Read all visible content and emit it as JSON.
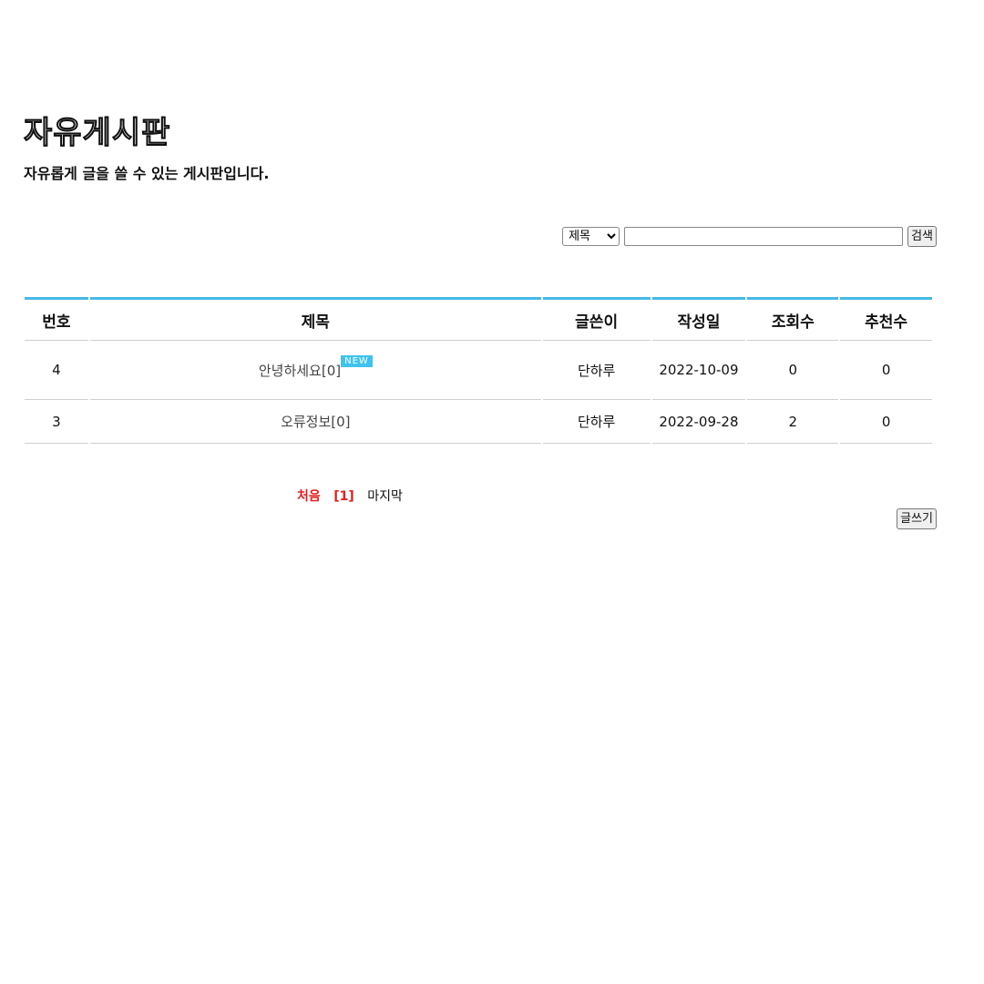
{
  "header": {
    "title": "자유게시판",
    "subtitle": "자유롭게 글을 쓸 수 있는 게시판입니다."
  },
  "search": {
    "field_selected": "제목",
    "query_value": "",
    "button_label": "검색"
  },
  "table": {
    "columns": [
      "번호",
      "제목",
      "글쓴이",
      "작성일",
      "조회수",
      "추천수"
    ],
    "rows": [
      {
        "no": "4",
        "subject": "안녕하세요[0]",
        "is_new": true,
        "badge": "NEW",
        "author": "단하루",
        "date": "2022-10-09",
        "views": "0",
        "recommends": "0"
      },
      {
        "no": "3",
        "subject": "오류정보[0]",
        "is_new": false,
        "author": "단하루",
        "date": "2022-09-28",
        "views": "2",
        "recommends": "0"
      }
    ]
  },
  "pagination": {
    "first": "처음",
    "current": "[1]",
    "last": "마지막"
  },
  "actions": {
    "write_label": "글쓰기"
  },
  "colors": {
    "accent_border": "#46b8e8",
    "new_badge": "#3fc3ee",
    "pager_active": "#e02020"
  }
}
